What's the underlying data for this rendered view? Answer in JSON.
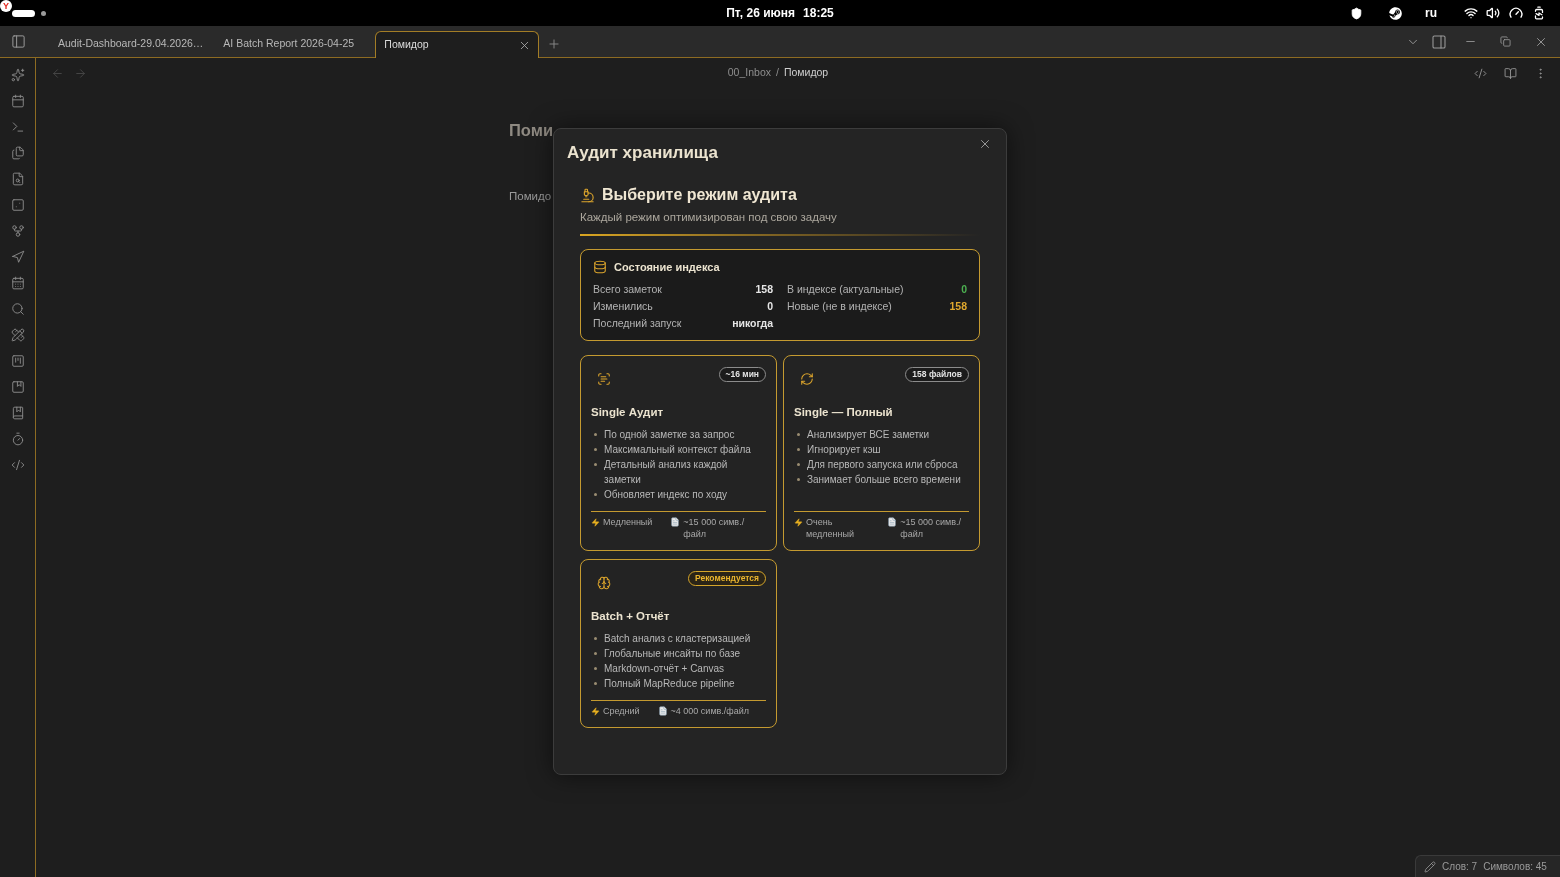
{
  "system_bar": {
    "logo": "Y",
    "date": "Пт, 26 июня",
    "time": "18:25",
    "keyboard_layout": "ru"
  },
  "tabs": [
    {
      "label": "Audit-Dashboard-29.04.2026…",
      "selected": false
    },
    {
      "label": "AI Batch Report 2026-04-25",
      "selected": false
    },
    {
      "label": "Помидор",
      "selected": true
    }
  ],
  "history": {
    "back": {
      "disabled": true
    },
    "forward": {
      "disabled": true
    }
  },
  "breadcrumb": {
    "folder": "00_Inbox",
    "separator": "/",
    "note": "Помидор"
  },
  "note": {
    "title": "Поми",
    "body": "Помидо"
  },
  "dialog": {
    "title": "Аудит хранилища",
    "heading": "Выберите режим аудита",
    "subtitle": "Каждый режим оптимизирован под свою задачу",
    "index_status": {
      "title": "Состояние индекса",
      "columns": [
        {
          "rows": [
            {
              "label": "Всего заметок",
              "value": "158",
              "color": "#e6e6e6"
            },
            {
              "label": "Изменились",
              "value": "0",
              "color": "#e6e6e6"
            },
            {
              "label": "Последний запуск",
              "value": "никогда",
              "color": "#e6e6e6"
            }
          ]
        },
        {
          "rows": [
            {
              "label": "В индексе (актуальные)",
              "value": "0",
              "color": "#4caf50"
            },
            {
              "label": "Новые (не в индексе)",
              "value": "158",
              "color": "#e0a82e"
            }
          ]
        }
      ]
    },
    "modes": [
      {
        "kind": "single",
        "badge": "~16 мин",
        "recommended": false,
        "title": "Single Аудит",
        "features": [
          "По одной заметке за запрос",
          "Максимальный контекст файла",
          "Детальный анализ каждой заметки",
          "Обновляет индекс по ходу"
        ],
        "speed": "Медленный",
        "size": "~15 000 симв./файл"
      },
      {
        "kind": "full",
        "badge": "158 файлов",
        "recommended": false,
        "title": "Single — Полный",
        "features": [
          "Анализирует ВСЕ заметки",
          "Игнорирует кэш",
          "Для первого запуска или сброса",
          "Занимает больше всего времени"
        ],
        "speed": "Очень медленный",
        "size": "~15 000 симв./файл"
      },
      {
        "kind": "batch",
        "badge": "Рекомендуется",
        "recommended": true,
        "title": "Batch + Отчёт",
        "features": [
          "Batch анализ с кластеризацией",
          "Глобальные инсайты по базе",
          "Markdown-отчёт + Canvas",
          "Полный MapReduce pipeline"
        ],
        "speed": "Средний",
        "size": "~4 000 симв./файл"
      }
    ]
  },
  "status_bar": {
    "words": "Слов: 7",
    "characters": "Символов: 45"
  }
}
